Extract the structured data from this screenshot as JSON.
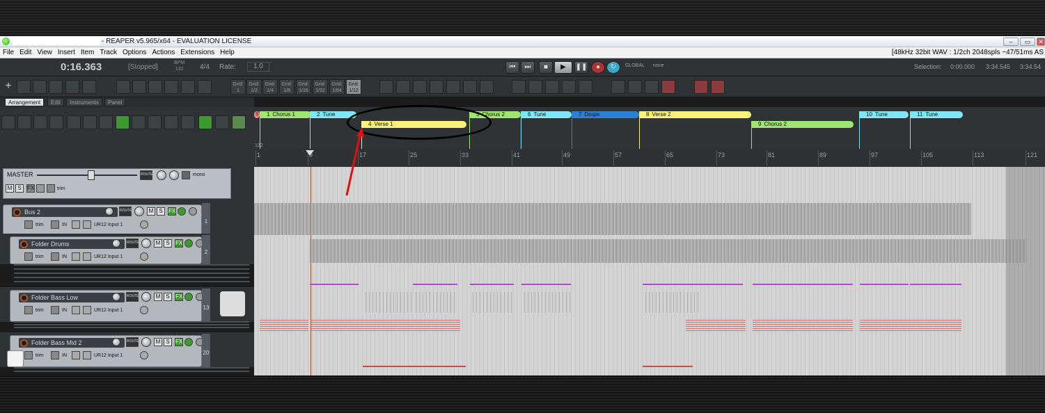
{
  "window": {
    "title": "- REAPER v5.965/x64 - EVALUATION LICENSE",
    "minimize": "–",
    "restore": "▭",
    "close": "✕"
  },
  "menu": {
    "items": [
      "File",
      "Edit",
      "View",
      "Insert",
      "Item",
      "Track",
      "Options",
      "Actions",
      "Extensions",
      "Help"
    ],
    "info": "[48kHz 32bit WAV : 1/2ch 2048spls ~47/51ms AS"
  },
  "transport": {
    "time": "0:16.363",
    "state": "[Stopped]",
    "bpm_label": "BPM",
    "bpm": "132",
    "timesig": "4/4",
    "rate_label": "Rate:",
    "rate": "1.0",
    "global_label": "GLOBAL",
    "global_value": "none",
    "selection_label": "Selection:",
    "sel_start": "0:00.000",
    "sel_end": "3:34.545",
    "sel_length": "3:34.54"
  },
  "grid_buttons": [
    {
      "label": "Grid:",
      "value": "1"
    },
    {
      "label": "Grid:",
      "value": "1/2"
    },
    {
      "label": "Grid:",
      "value": "1/4"
    },
    {
      "label": "Grid:",
      "value": "1/8"
    },
    {
      "label": "Grid:",
      "value": "1/16"
    },
    {
      "label": "Grid:",
      "value": "1/32"
    },
    {
      "label": "Grid:",
      "value": "1/64"
    },
    {
      "label": "Grid:",
      "value": "1/12"
    }
  ],
  "tabs": [
    "Arrangement",
    "Edit",
    "Instruments",
    "Panel"
  ],
  "regions": [
    {
      "num": "1",
      "name": "Chorus 1"
    },
    {
      "num": "2",
      "name": "Tune"
    },
    {
      "num": "4",
      "name": "Verse 1"
    },
    {
      "num": "5",
      "name": "Chorus 2"
    },
    {
      "num": "6",
      "name": "Tune"
    },
    {
      "num": "7",
      "name": "Drope"
    },
    {
      "num": "8",
      "name": "Verse 2"
    },
    {
      "num": "9",
      "name": "Chorus 2"
    },
    {
      "num": "10",
      "name": "Tune"
    },
    {
      "num": "11",
      "name": "Tune"
    }
  ],
  "region_first": "3",
  "ruler": {
    "tempo": "132",
    "bars": [
      "1",
      "9",
      "17",
      "25",
      "33",
      "41",
      "49",
      "57",
      "65",
      "73",
      "81",
      "89",
      "97",
      "105",
      "113",
      "121"
    ]
  },
  "master": {
    "name": "MASTER",
    "route": "ROUTE",
    "mono": "mono",
    "m": "M",
    "s": "S",
    "fx": "FX",
    "trim": "trim"
  },
  "tracks": [
    {
      "name": "Bus 2",
      "input": "UR12 Input 1",
      "number": "1"
    },
    {
      "name": "Folder Drums",
      "input": "UR12 Input 1",
      "number": "2"
    },
    {
      "name": "Folder Bass Low",
      "input": "UR12 Input 1",
      "number": "13"
    },
    {
      "name": "Folder Bass Mid 2",
      "input": "UR12 Input 1",
      "number": "20"
    }
  ],
  "track_labels": {
    "route": "ROUTE",
    "m": "M",
    "s": "S",
    "fx": "FX",
    "trim": "trim",
    "in": "IN"
  }
}
